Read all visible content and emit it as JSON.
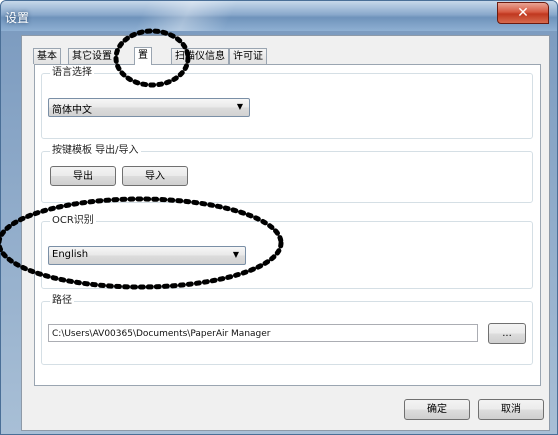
{
  "window": {
    "title": "设置",
    "close_glyph": "✕"
  },
  "tabs": [
    {
      "label": "基本"
    },
    {
      "label": "其它设置"
    },
    {
      "label": "置"
    },
    {
      "label": "扫描仪信息"
    },
    {
      "label": "许可证"
    }
  ],
  "language_group": {
    "title": "语言选择",
    "selected": "简体中文",
    "arrow_icon": "chevron-down"
  },
  "button_template_group": {
    "title": "按键模板 导出/导入",
    "export_label": "导出",
    "import_label": "导入"
  },
  "ocr_group": {
    "title": "OCR识别",
    "selected": "English",
    "arrow_icon": "chevron-down"
  },
  "path_group": {
    "title": "路径",
    "value": "C:\\Users\\AV00365\\Documents\\PaperAir Manager",
    "browse_label": "..."
  },
  "footer": {
    "ok_label": "确定",
    "cancel_label": "取消"
  },
  "colors": {
    "annotation": "#000000",
    "close_button": "#c7402a"
  }
}
